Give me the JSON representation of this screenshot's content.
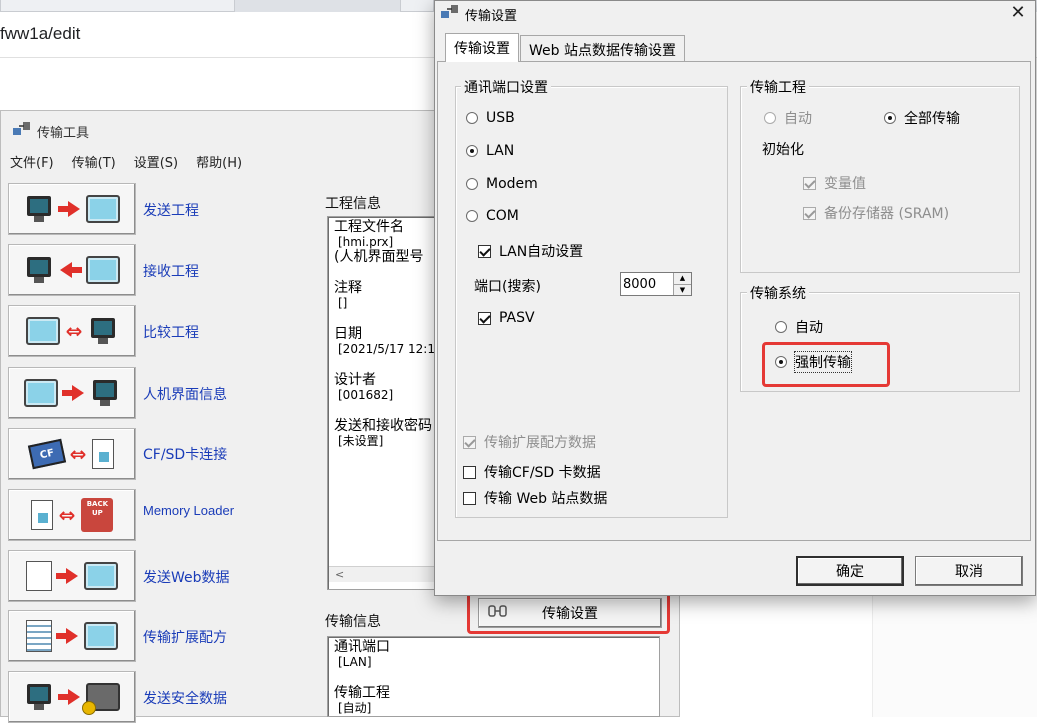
{
  "browser": {
    "url_fragment": "fww1a/edit"
  },
  "main_window": {
    "title": "传输工具",
    "menu": [
      "文件(F)",
      "传输(T)",
      "设置(S)",
      "帮助(H)"
    ],
    "actions": [
      {
        "label": "发送工程",
        "icon": "send-project-icon"
      },
      {
        "label": "接收工程",
        "icon": "receive-project-icon"
      },
      {
        "label": "比较工程",
        "icon": "compare-project-icon"
      },
      {
        "label": "人机界面信息",
        "icon": "hmi-info-icon"
      },
      {
        "label": "CF/SD卡连接",
        "icon": "cf-sd-card-icon"
      },
      {
        "label": "Memory Loader",
        "icon": "memory-loader-icon"
      },
      {
        "label": "发送Web数据",
        "icon": "send-web-data-icon"
      },
      {
        "label": "传输扩展配方",
        "icon": "extended-recipe-icon"
      },
      {
        "label": "发送安全数据",
        "icon": "send-security-data-icon"
      }
    ],
    "project_info": {
      "label": "工程信息",
      "fields": [
        {
          "key": "工程文件名",
          "value": "[hmi.prx]",
          "extra": "(人机界面型号"
        },
        {
          "key": "注释",
          "value": "[]"
        },
        {
          "key": "日期",
          "value": "[2021/5/17 12:1"
        },
        {
          "key": "设计者",
          "value": "[001682]"
        },
        {
          "key": "发送和接收密码",
          "value": "[未设置]"
        }
      ],
      "scroll_left_glyph": "<"
    },
    "transfer_info": {
      "label": "传输信息",
      "fields": [
        {
          "key": "通讯端口",
          "value": "[LAN]"
        },
        {
          "key": "传输工程",
          "value": "[自动]"
        }
      ]
    },
    "transfer_settings_button": "传输设置"
  },
  "dialog": {
    "title": "传输设置",
    "close_glyph": "✕",
    "tabs": [
      "传输设置",
      "Web 站点数据传输设置"
    ],
    "comm_port": {
      "legend": "通讯端口设置",
      "options": [
        "USB",
        "LAN",
        "Modem",
        "COM"
      ],
      "selected": "LAN",
      "lan_auto_label": "LAN自动设置",
      "lan_auto_checked": true,
      "port_label": "端口(搜索)",
      "port_value": "8000",
      "pasv_label": "PASV",
      "pasv_checked": true
    },
    "extra_checks": [
      {
        "label": "传输扩展配方数据",
        "checked": true,
        "disabled": true
      },
      {
        "label": "传输CF/SD 卡数据",
        "checked": false,
        "disabled": false
      },
      {
        "label": "传输 Web 站点数据",
        "checked": false,
        "disabled": false
      }
    ],
    "transfer_project": {
      "legend": "传输工程",
      "auto_label": "自动",
      "all_label": "全部传输",
      "selected": "全部传输",
      "init_label": "初始化",
      "var_label": "变量值",
      "sram_label": "备份存储器 (SRAM)"
    },
    "transfer_system": {
      "legend": "传输系统",
      "auto_label": "自动",
      "force_label": "强制传输",
      "selected": "强制传输"
    },
    "ok_label": "确定",
    "cancel_label": "取消"
  },
  "colors": {
    "highlight": "#e53935",
    "link_blue": "#1a3cb8"
  }
}
